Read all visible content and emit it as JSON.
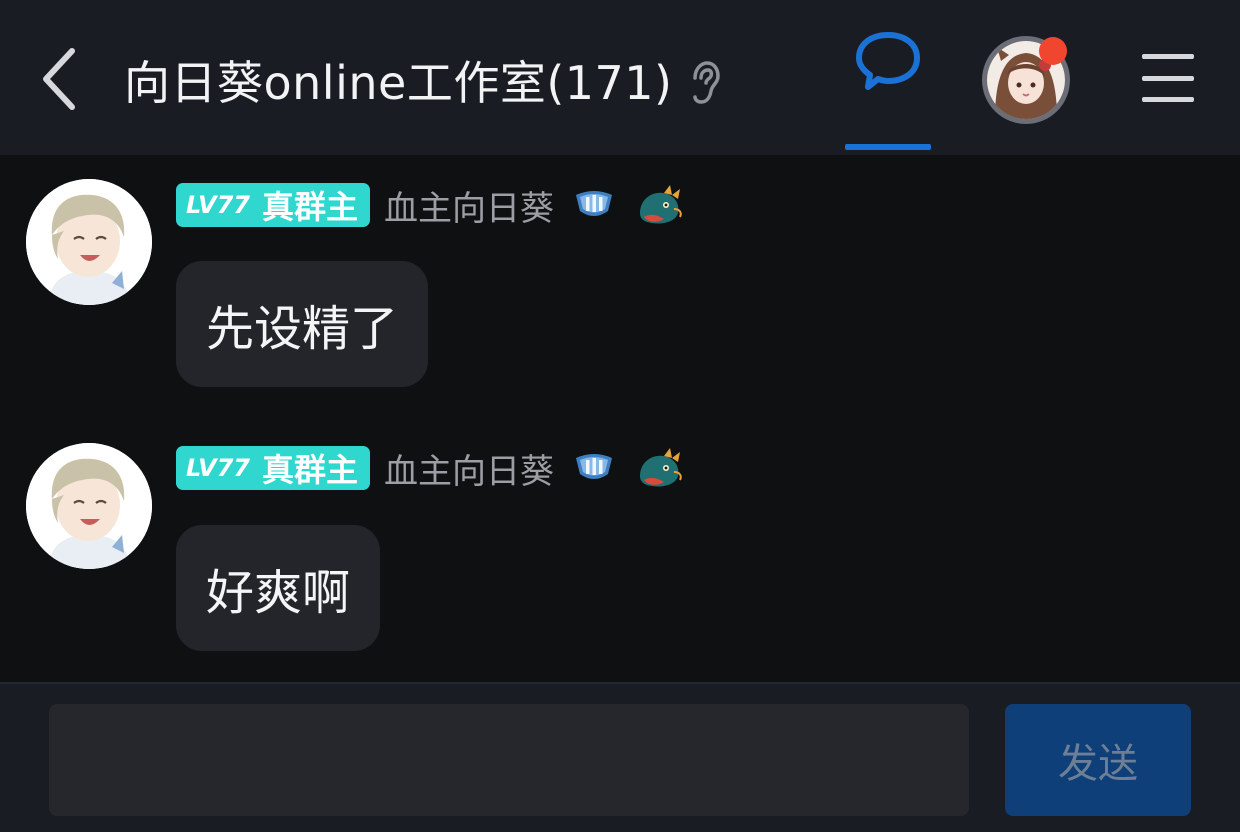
{
  "header": {
    "back_icon": "chevron-left-icon",
    "title": "向日葵online工作室(171)",
    "ear_icon": "ear-icon",
    "chat_tab_icon": "chat-bubble-icon",
    "menu_icon": "hamburger-menu-icon",
    "accent_color": "#1a72d6",
    "notification_dot_color": "#f0452f"
  },
  "messages": [
    {
      "badge_level": "LV77",
      "badge_role": "真群主",
      "badge_color": "#2fd7cf",
      "sender": "血主向日葵",
      "text": "先设精了"
    },
    {
      "badge_level": "LV77",
      "badge_role": "真群主",
      "badge_color": "#2fd7cf",
      "sender": "血主向日葵",
      "text": "好爽啊"
    }
  ],
  "composer": {
    "input_value": "",
    "input_placeholder": "",
    "send_label": "发送",
    "send_color": "#0e3f78"
  }
}
